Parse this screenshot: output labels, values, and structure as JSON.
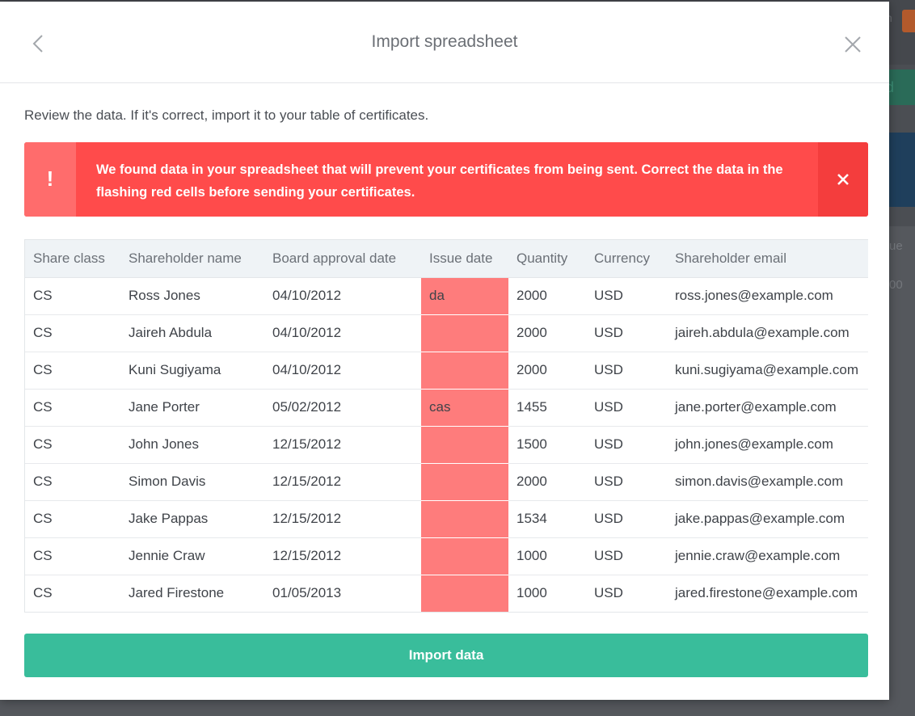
{
  "modal": {
    "title": "Import spreadsheet",
    "intro": "Review the data. If it's correct, import it to your table of certificates.",
    "alert": {
      "icon": "!",
      "message": "We found data in your spreadsheet that will prevent your certificates from being sent. Correct the data in the flashing red cells before sending your certificates."
    },
    "table": {
      "columns": [
        "Share class",
        "Shareholder name",
        "Board approval date",
        "Issue date",
        "Quantity",
        "Currency",
        "Shareholder email"
      ],
      "rows": [
        [
          "CS",
          "Ross Jones",
          "04/10/2012",
          "da",
          "2000",
          "USD",
          "ross.jones@example.com"
        ],
        [
          "CS",
          "Jaireh Abdula",
          "04/10/2012",
          "",
          "2000",
          "USD",
          "jaireh.abdula@example.com"
        ],
        [
          "CS",
          "Kuni Sugiyama",
          "04/10/2012",
          "",
          "2000",
          "USD",
          "kuni.sugiyama@example.com"
        ],
        [
          "CS",
          "Jane Porter",
          "05/02/2012",
          "cas",
          "1455",
          "USD",
          "jane.porter@example.com"
        ],
        [
          "CS",
          "John Jones",
          "12/15/2012",
          "",
          "1500",
          "USD",
          "john.jones@example.com"
        ],
        [
          "CS",
          "Simon Davis",
          "12/15/2012",
          "",
          "2000",
          "USD",
          "simon.davis@example.com"
        ],
        [
          "CS",
          "Jake Pappas",
          "12/15/2012",
          "",
          "1534",
          "USD",
          "jake.pappas@example.com"
        ],
        [
          "CS",
          "Jennie Craw",
          "12/15/2012",
          "",
          "1000",
          "USD",
          "jennie.craw@example.com"
        ],
        [
          "CS",
          "Jared Firestone",
          "01/05/2013",
          "",
          "1000",
          "USD",
          "jared.firestone@example.com"
        ]
      ],
      "error_column": 3
    },
    "import_label": "Import data"
  },
  "background": {
    "user_initial": "n",
    "add_label": "d",
    "column_fragment": "ue",
    "value_fragment": "00"
  },
  "colors": {
    "alert_bg": "#ff4b4b",
    "error_cell": "#fe7c7c",
    "primary": "#39bd9b"
  },
  "icons": {
    "back": "chevron-left-icon",
    "close": "close-icon",
    "alert": "exclamation-icon",
    "alert_close": "close-icon"
  }
}
